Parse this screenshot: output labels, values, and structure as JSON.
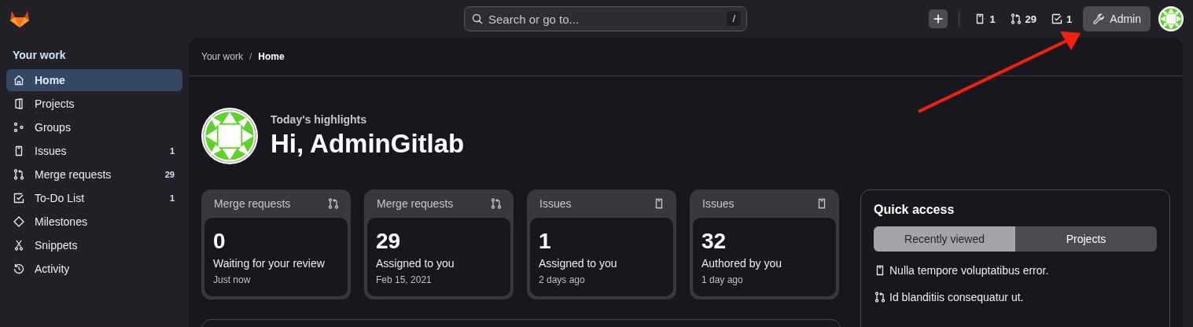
{
  "top_bar": {
    "search": {
      "placeholder": "Search or go to...",
      "shortcut": "/"
    },
    "counters": [
      {
        "kind": "issue",
        "count": "1"
      },
      {
        "kind": "merge_request",
        "count": "29"
      },
      {
        "kind": "todo",
        "count": "1"
      }
    ],
    "admin_button": "Admin"
  },
  "sidebar": {
    "title": "Your work",
    "items": [
      {
        "label": "Home",
        "selected": true
      },
      {
        "label": "Projects",
        "selected": false
      },
      {
        "label": "Groups",
        "selected": false
      },
      {
        "label": "Issues",
        "selected": false,
        "count": "1"
      },
      {
        "label": "Merge requests",
        "selected": false,
        "count": "29"
      },
      {
        "label": "To-Do List",
        "selected": false,
        "count": "1"
      },
      {
        "label": "Milestones",
        "selected": false
      },
      {
        "label": "Snippets",
        "selected": false
      },
      {
        "label": "Activity",
        "selected": false
      }
    ]
  },
  "breadcrumb": {
    "items": [
      "Your work",
      "Home"
    ],
    "separator": "/"
  },
  "greeting": {
    "subtitle": "Today's highlights",
    "title": "Hi, AdminGitlab"
  },
  "cards": [
    {
      "kind": "merge_request",
      "title": "Merge requests",
      "value": "0",
      "label": "Waiting for your review",
      "time": "Just now"
    },
    {
      "kind": "merge_request",
      "title": "Merge requests",
      "value": "29",
      "label": "Assigned to you",
      "time": "Feb 15, 2021"
    },
    {
      "kind": "issue",
      "title": "Issues",
      "value": "1",
      "label": "Assigned to you",
      "time": "2 days ago"
    },
    {
      "kind": "issue",
      "title": "Issues",
      "value": "32",
      "label": "Authored by you",
      "time": "1 day ago"
    }
  ],
  "quick_access": {
    "title": "Quick access",
    "tabs": [
      {
        "label": "Recently viewed",
        "selected": true
      },
      {
        "label": "Projects",
        "selected": false
      }
    ],
    "items": [
      {
        "kind": "issue",
        "text": "Nulla tempore voluptatibus error."
      },
      {
        "kind": "merge_request",
        "text": "Id blanditiis consequatur ut."
      }
    ]
  }
}
